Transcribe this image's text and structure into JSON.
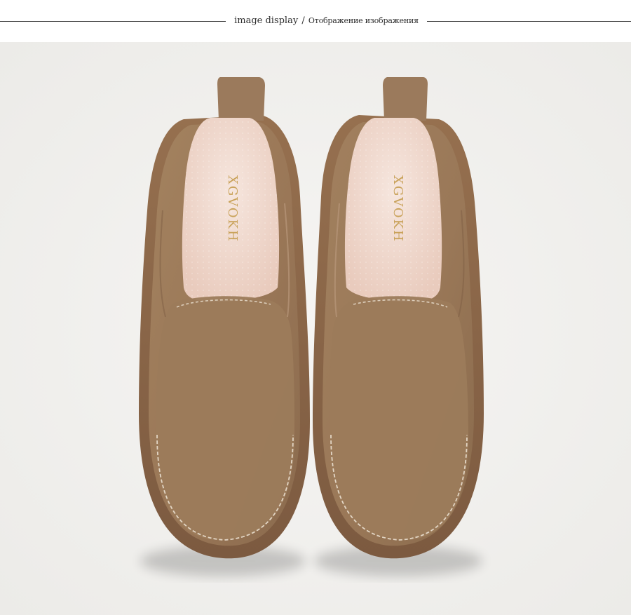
{
  "header": {
    "caption_en": "image display",
    "separator": "/",
    "caption_ru": "Отображение изображения"
  },
  "photo": {
    "background_color": "#f3f2f0",
    "subject": "pair of suede slip-on loafers",
    "suede_color": "#9b7a5c",
    "sole_color": "#8a6448",
    "insole_color": "#f1ddd3",
    "stitch_color": "#eadfcf",
    "insole_brand_left": "XGVOKH",
    "insole_brand_right": "XGVOKH"
  }
}
